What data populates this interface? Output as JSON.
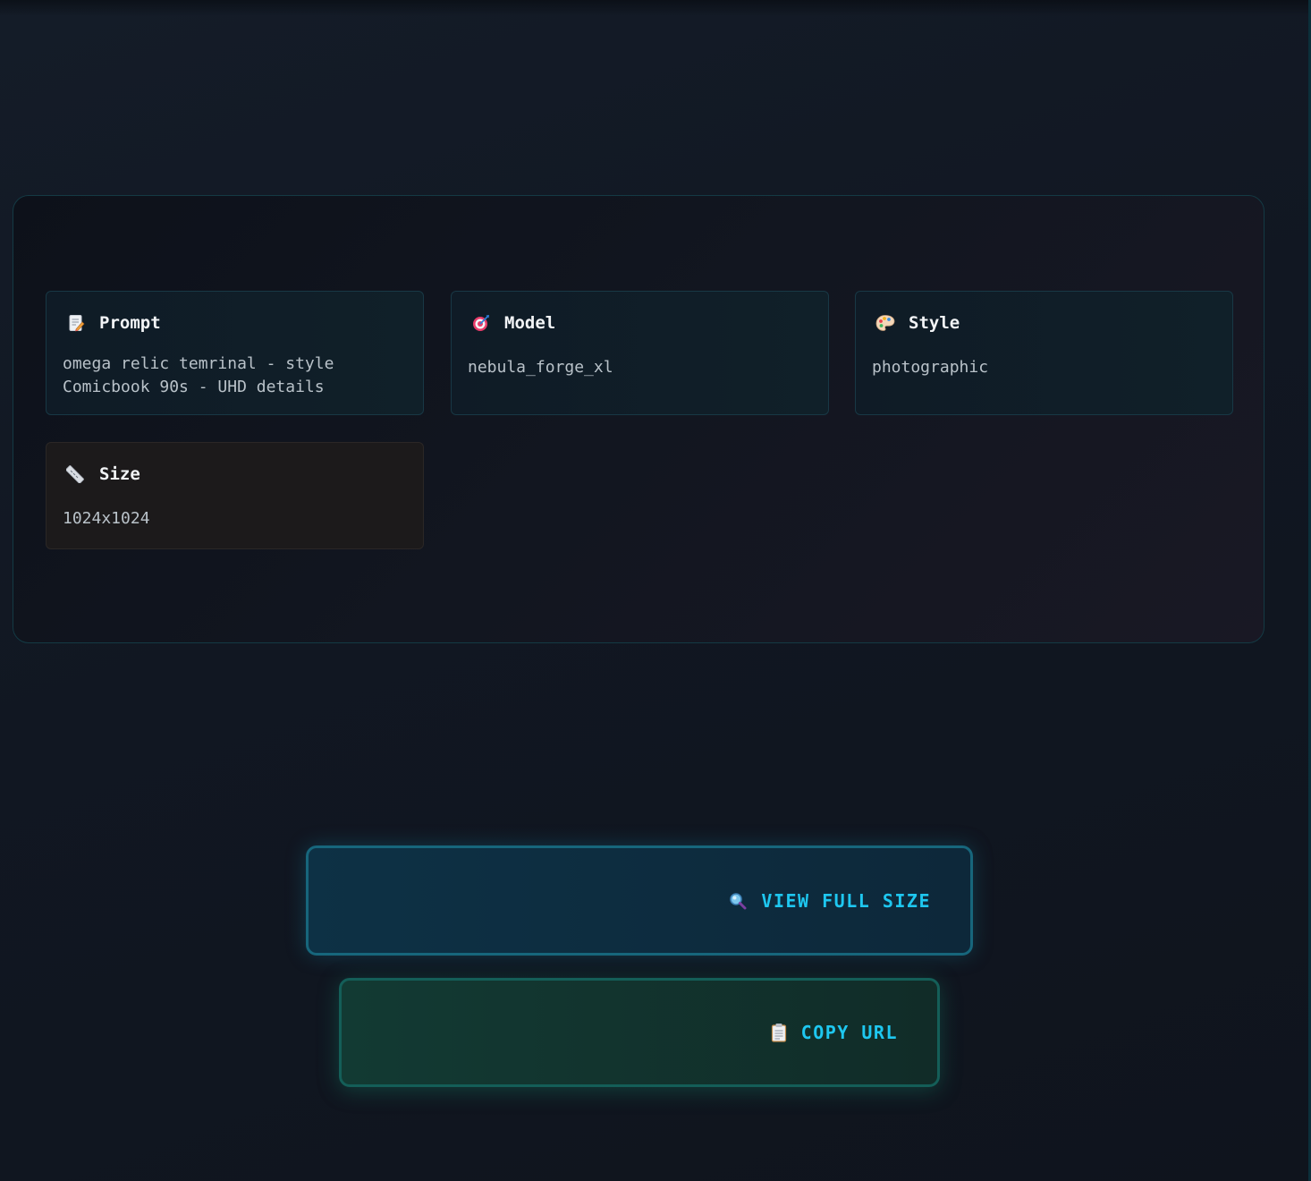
{
  "details": {
    "prompt": {
      "icon": "memo-icon",
      "title": "Prompt",
      "value": "omega relic temrinal - style\nComicbook 90s - UHD details"
    },
    "model": {
      "icon": "target-icon",
      "title": "Model",
      "value": "nebula_forge_xl"
    },
    "style": {
      "icon": "palette-icon",
      "title": "Style",
      "value": "photographic"
    },
    "size": {
      "icon": "ruler-icon",
      "title": "Size",
      "value": "1024x1024"
    }
  },
  "actions": {
    "view": {
      "icon": "magnifier-icon",
      "label": "VIEW FULL SIZE"
    },
    "copy": {
      "icon": "clipboard-icon",
      "label": "COPY URL"
    }
  },
  "colors": {
    "accent": "#1ec7f0",
    "background": "#111722",
    "panel_border": "#143a44"
  }
}
